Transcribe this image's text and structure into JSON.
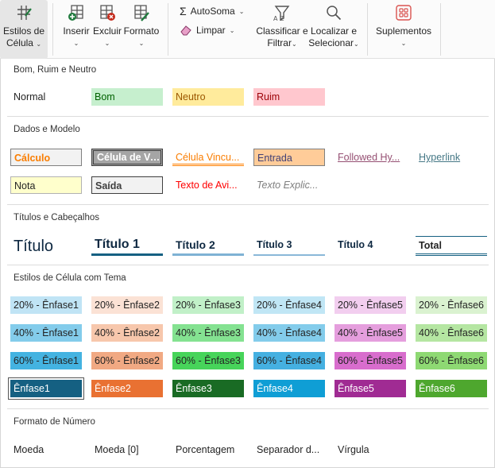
{
  "ribbon": {
    "estilos": {
      "line1": "Estilos de",
      "line2": "Célula"
    },
    "inserir": "Inserir",
    "excluir": "Excluir",
    "formato": "Formato",
    "autosoma": "AutoSoma",
    "limpar": "Limpar",
    "classificar": {
      "line1": "Classificar e",
      "line2": "Filtrar"
    },
    "localizar": {
      "line1": "Localizar e",
      "line2": "Selecionar"
    },
    "suplementos": "Suplementos"
  },
  "sections": {
    "bom": "Bom, Ruim e Neutro",
    "dados": "Dados e Modelo",
    "titulos": "Títulos e Cabeçalhos",
    "tema": "Estilos de Célula com Tema",
    "numero": "Formato de Número"
  },
  "styles": {
    "normal": "Normal",
    "bom": "Bom",
    "neutro": "Neutro",
    "ruim": "Ruim",
    "calculo": "Cálculo",
    "celula_verif": "Célula de Ve...",
    "celula_vinc": "Célula Vincu...",
    "entrada": "Entrada",
    "followed": "Followed Hy...",
    "hyperlink": "Hyperlink",
    "nota": "Nota",
    "saida": "Saída",
    "texto_aviso": "Texto de Avi...",
    "texto_expl": "Texto Explic...",
    "titulo": "Título",
    "titulo1": "Título 1",
    "titulo2": "Título 2",
    "titulo3": "Título 3",
    "titulo4": "Título 4",
    "total": "Total"
  },
  "accent_rows": [
    [
      "20% - Ênfase1",
      "20% - Ênfase2",
      "20% - Ênfase3",
      "20% - Ênfase4",
      "20% - Ênfase5",
      "20% - Ênfase6"
    ],
    [
      "40% - Ênfase1",
      "40% - Ênfase2",
      "40% - Ênfase3",
      "40% - Ênfase4",
      "40% - Ênfase5",
      "40% - Ênfase6"
    ],
    [
      "60% - Ênfase1",
      "60% - Ênfase2",
      "60% - Ênfase3",
      "60% - Ênfase4",
      "60% - Ênfase5",
      "60% - Ênfase6"
    ],
    [
      "Ênfase1",
      "Ênfase2",
      "Ênfase3",
      "Ênfase4",
      "Ênfase5",
      "Ênfase6"
    ]
  ],
  "accent_colors": {
    "row20": [
      "#c0e4f5",
      "#fbe2d5",
      "#c1f0c8",
      "#c0e6f5",
      "#f2ceef",
      "#daf2d0"
    ],
    "row40": [
      "#83cceb",
      "#f7c7ac",
      "#84e291",
      "#83cceb",
      "#e59edd",
      "#b5e6a2"
    ],
    "row60": [
      "#44b3e1",
      "#f1a983",
      "#47d45a",
      "#45b0e1",
      "#d86dcd",
      "#8ed973"
    ],
    "row100": [
      "#156082",
      "#e97132",
      "#196b24",
      "#0f9ed5",
      "#a02b93",
      "#4ea72e"
    ]
  },
  "number_formats": [
    "Moeda",
    "Moeda [0]",
    "Porcentagem",
    "Separador d...",
    "Vírgula"
  ]
}
